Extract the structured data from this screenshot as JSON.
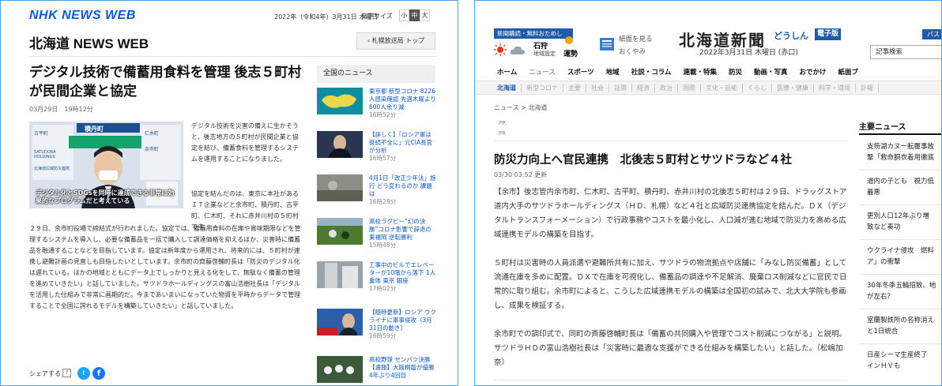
{
  "left": {
    "logo": "NHK NEWS WEB",
    "date": "2022年（令和4年）3月31日 木曜日",
    "fontsize_label": "文字サイズ",
    "fontsizes": [
      "小",
      "中",
      "大"
    ],
    "region_title": "北海道 NEWS WEB",
    "region_top_button": "札幌放送局 トップ",
    "article": {
      "title": "デジタル技術で備蓄用食料を管理 後志５町村が民間企業と協定",
      "date": "03月29日　19時12分",
      "image_caption": "デジタル化とSDGsを同時に達成できる非常に効果的なプログラムだと考えている",
      "image_banner": "積丹町",
      "image_labels": [
        "古平町",
        "仁木町",
        "余市町",
        "SATUDORA HOLDINGS",
        "北海道広域防災連携"
      ],
      "p1": "デジタル技術を災害の備えに生かそうと、後志地方の５町村が民間企業と協定を結び、備蓄食料を管理するシステムを運用することになりました。",
      "p2": "協定を結んだのは、東京に本社がある ＩＴ企業などと余市町、積丹町、古平町、仁木町、それに赤井川村の５町村です。",
      "p3": "２９日、余市町役場で締結式が行われました。協定では、備蓄用食料の在庫や賞味期限などを管理するシステムを導入し、必要な備蓄品を一括で購入して調達価格を抑えるほか、災害時に備蓄品を融通することなどを目指しています。協定は新年度から運用され、将来的には、５町村が連携し避難計画の見直しも目指したいとしています。余市町の齊藤啓輔町長は「防災のデジタル化は遅れている。ほかの地域とともにデータ上でしっかりと見える化をして、無駄なく備蓄の管理を進めていきたい」と話していました。サツドラホールディングスの富山浩樹社長は「デジタルを活用した仕組みで非常に画期的だ。今まであいまいになっていた物資を平時からデータで管理することで全国に誇れるモデルを構築していきたい」と話していました。"
    },
    "share_label": "シェアする",
    "share_q": "?",
    "share_icons": [
      "twitter-icon",
      "facebook-icon"
    ],
    "side": {
      "heading": "全国のニュース",
      "items": [
        {
          "text": "東京都 新型コロナ 8226人感染確認 先週木曜より600人余り減",
          "time": "16時52分"
        },
        {
          "text": "【詳しく】「ロシア軍は掛続不全に」元CIA長官が分析",
          "time": "16時57分"
        },
        {
          "text": "4月1日「改正少年法」施行 どう変わるのか 課題は",
          "time": "16時28分"
        },
        {
          "text": "高校ラグビー“幻の決勝”コロナ影響で辞退の東福岡 逆転勝利",
          "time": "15時48分"
        },
        {
          "text": "工事中のビルでエレベーターが10階から落下 1人重体 東京 銀座",
          "time": "17時02分"
        },
        {
          "text": "【随時更新】ロシア ウクライナに軍事侵攻（3月31日の動き）",
          "time": "16時59分"
        },
        {
          "text": "高校野球 センバツ決勝【速報】大阪桐蔭が優勝 4年ぶり4回目",
          "time": ""
        }
      ]
    }
  },
  "right": {
    "top_button": "新聞購読・無料おためし",
    "weather_city": "石狩",
    "weather_sub": "地域設定",
    "fortune_label": "運勢",
    "paper_links": [
      "紙面を見る",
      "おくやみ"
    ],
    "brand": "北海道新聞",
    "brand_sub": "どうしん",
    "brand_sub2": "電子版",
    "pass_label": "パス",
    "date": "2022年3月31日 木曜日 (赤口)",
    "search_placeholder": "記事検索",
    "nav": [
      "ホーム",
      "ニュース",
      "スポーツ",
      "地域",
      "社説・コラム",
      "連載・特集",
      "防災",
      "動画・写真",
      "おでかけ",
      "紙面ブ"
    ],
    "subnav": [
      "北海道",
      "新型コロナ",
      "主要",
      "社会",
      "話題",
      "経済",
      "政治",
      "国際",
      "文化・芸能",
      "くらし",
      "医療・健康",
      "科学・環境",
      "訃報"
    ],
    "breadcrumb": "ニュース > 北海道",
    "pr": [
      "PR",
      "PR"
    ],
    "article": {
      "title": "防災力向上へ官民連携　北後志５町村とサツドラなど４社",
      "timestamp": "03/30 03:52 更新",
      "p1": "【余市】後志管内余市町、仁木町、古平町、積丹町、赤井川村の北後志５町村は２９日、ドラッグストア道内大手のサツドラホールディングス（ＨＤ、札幌）など４社と広域防災連携協定を結んだ。ＤＸ（デジタルトランスフォーメーション）で行政事務やコストを最小化し、人口減が進む地域で防災力を高める広域連携モデルの構築を目指す。",
      "p2": "５町村は災害時の人員派遣や避難所共有に加え、サツドラの物流拠点や店舗に「みなし防災備蓄」として流通在庫を多めに配置。ＤＸで在庫を可視化し、備蓄品の調達や不足解消、廃棄ロス削減などに官民で日常的に取り組む。余市町によると、こうした広域連携モデルの構築は全国初の試みで、北大大学院も参画し、成果を検証する。",
      "p3": "余市町での調印式で、同町の斉藤啓輔町長は「備蓄の共同購入や管理でコスト削減につながる」と説明。サツドラＨＤの富山浩樹社長は「災害時に最適な支援ができる仕組みを構築したい」と話した。（松嶋加奈）"
    },
    "main_news": {
      "heading": "主要ニュース",
      "items": [
        "支笏湖カヌー転覆事故",
        "撃「救命胴衣着用徹底",
        "道内の子ども　視力低",
        "最悪",
        "更別人口12年ぶり増",
        "致など奏功",
        "ウクライナ侵攻　燃料",
        "ア」の衝撃",
        "30年冬季五輪招致、地",
        "が左右？",
        "室蘭製鉄所の名称消え",
        "と1日統合",
        "日産シーマ生産終了",
        "インＨＶも"
      ]
    },
    "colors": {
      "nhk_blue": "#0a5bd3",
      "doshin_blue": "#1e5aa8",
      "border": "#4aa3df"
    }
  }
}
